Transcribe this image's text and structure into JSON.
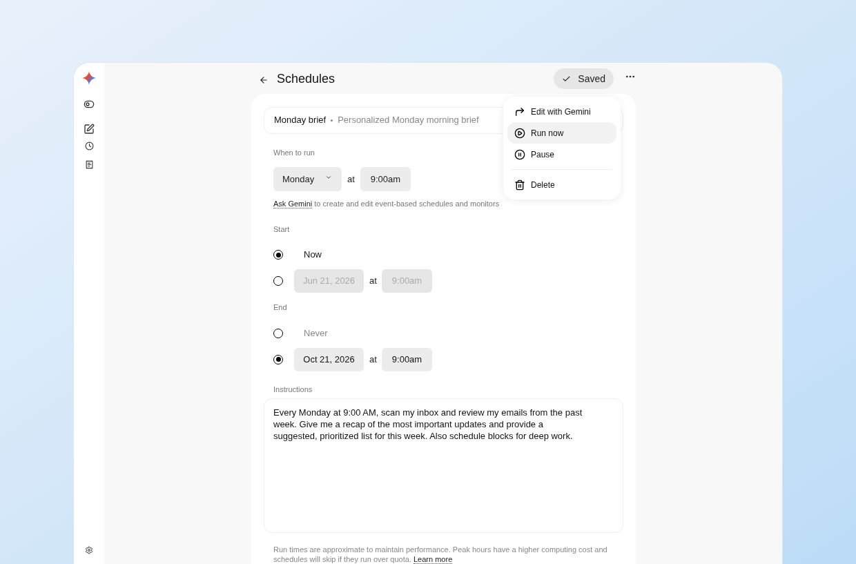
{
  "header": {
    "title": "Schedules",
    "status": "Saved"
  },
  "menu": [
    {
      "kind": "edit",
      "label": "Edit with Gemini",
      "selected": false
    },
    {
      "kind": "run",
      "label": "Run now",
      "selected": true
    },
    {
      "kind": "pause",
      "label": "Pause",
      "selected": false
    },
    {
      "kind": "delete",
      "label": "Delete",
      "selected": false
    }
  ],
  "schedule": {
    "name": "Monday brief",
    "description": "Personalized Monday morning brief"
  },
  "when_to_run": {
    "label": "When to run",
    "day": "Monday",
    "at": "at",
    "time": "9:00am"
  },
  "hint": {
    "link": "Ask Gemini",
    "text": "to create and edit event-based schedules and monitors"
  },
  "start": {
    "label": "Start",
    "options": [
      {
        "kind": "text",
        "label": "Now",
        "selected": true
      },
      {
        "kind": "datetime",
        "date": "Jun 21, 2026",
        "at": "at",
        "time": "9:00am",
        "selected": false
      }
    ]
  },
  "end": {
    "label": "End",
    "options": [
      {
        "kind": "text",
        "label": "Never",
        "selected": false
      },
      {
        "kind": "datetime",
        "date": "Oct 21, 2026",
        "at": "at",
        "time": "9:00am",
        "selected": true
      }
    ]
  },
  "instructions": {
    "label": "Instructions",
    "text": "Every Monday at 9:00 AM, scan my inbox and review my emails from the past week. Give me a recap of the most important updates and provide a suggested, prioritized list for this week. Also schedule blocks for deep work."
  },
  "footer": {
    "text": "Run times are approximate to maintain performance. Peak hours have a higher computing cost and schedules will skip if they run over quota.",
    "link": "Learn more"
  }
}
